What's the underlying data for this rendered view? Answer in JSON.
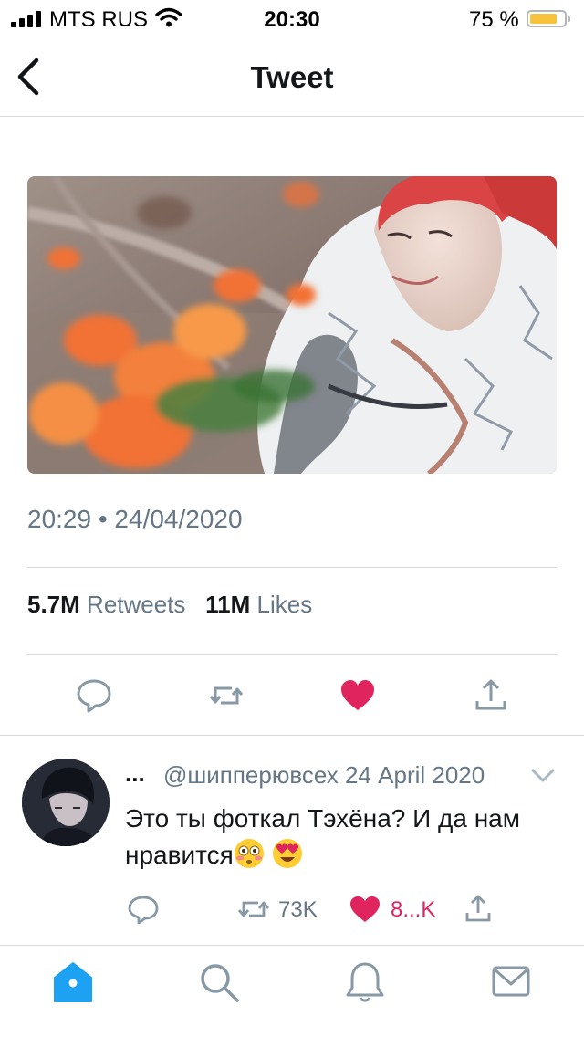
{
  "status_bar": {
    "carrier": "MTS RUS",
    "time": "20:30",
    "battery": "75 %"
  },
  "header": {
    "title": "Tweet"
  },
  "tweet": {
    "timestamp": "20:29 • 24/04/2020",
    "retweets_count": "5.7M",
    "retweets_label": "Retweets",
    "likes_count": "11M",
    "likes_label": "Likes"
  },
  "reply": {
    "name": "...",
    "handle": "@шипперювсех",
    "date": "24 April 2020",
    "text": "Это ты фоткал Тэхёна? И да нам нравится",
    "retweet_count": "73K",
    "like_count": "8...K"
  },
  "colors": {
    "accent": "#1da1f2",
    "like": "#e0245e",
    "icon": "#657786"
  },
  "icons": [
    "back-chevron",
    "reply",
    "retweet",
    "heart",
    "share",
    "home",
    "search",
    "bell",
    "mail"
  ]
}
